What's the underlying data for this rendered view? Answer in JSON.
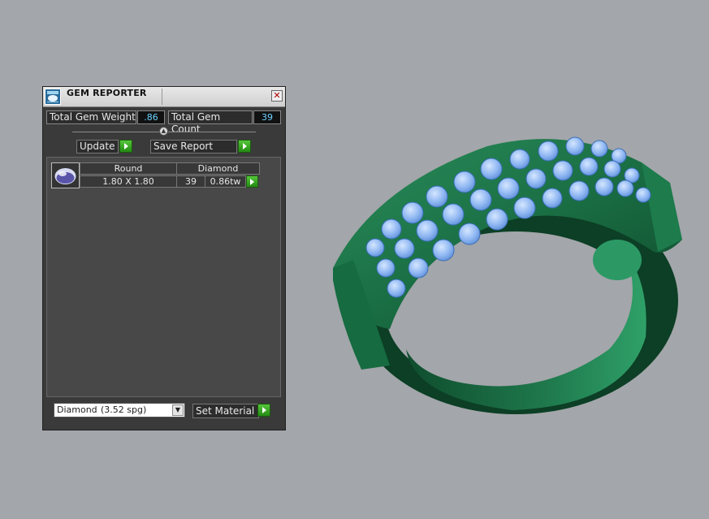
{
  "panel": {
    "title": "GEM REPORTER",
    "close_symbol": "✕",
    "total_weight_label": "Total Gem Weight",
    "total_weight_value": ".86",
    "total_count_label": "Total Gem Count",
    "total_count_value": "39",
    "update_label": "Update",
    "save_report_label": "Save Report",
    "gem_row": {
      "shape": "Round",
      "size": "1.80 X 1.80",
      "material": "Diamond",
      "count": "39",
      "weight": "0.86tw"
    },
    "material_select": {
      "material": "Diamond",
      "spg": "(3.52 spg)"
    },
    "set_material_label": "Set Material"
  },
  "icons": {
    "app": "gem-reporter-icon",
    "close": "close-icon",
    "go": "play-arrow-icon",
    "dropdown": "chevron-down-icon",
    "gem": "round-gem-icon"
  },
  "colors": {
    "ring_green": "#1f7a4d",
    "gem_blue": "#8fb7f2",
    "value_text": "#6cd2ff",
    "go_green": "#3aa826"
  }
}
